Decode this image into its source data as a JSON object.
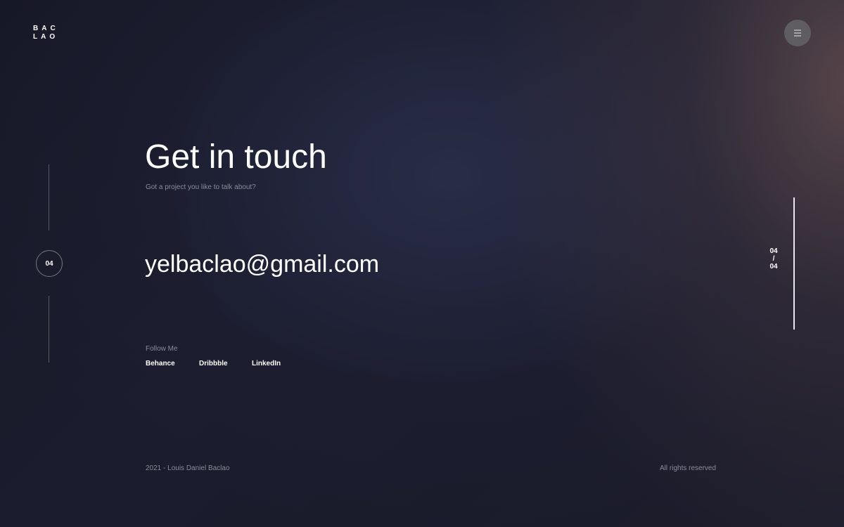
{
  "brand": {
    "logo_line1": "BAC",
    "logo_line2": "LAO"
  },
  "header": {
    "menu_icon": "hamburger-menu-icon"
  },
  "side_nav": {
    "current_section": "04"
  },
  "contact": {
    "title": "Get in touch",
    "subtitle": "Got a project you like to talk about?",
    "email": "yelbaclao@gmail.com"
  },
  "social": {
    "label": "Follow Me",
    "links": [
      "Behance",
      "Dribbble",
      "LinkedIn"
    ]
  },
  "pager": {
    "current": "04",
    "separator": "/",
    "total": "04"
  },
  "footer": {
    "copyright": "2021 - Louis Daniel Baclao",
    "rights": "All rights reserved"
  },
  "colors": {
    "background": "#1a1b2b",
    "text_primary": "#ffffff",
    "text_muted": "#8a8c99",
    "menu_button": "#5f5c62"
  }
}
